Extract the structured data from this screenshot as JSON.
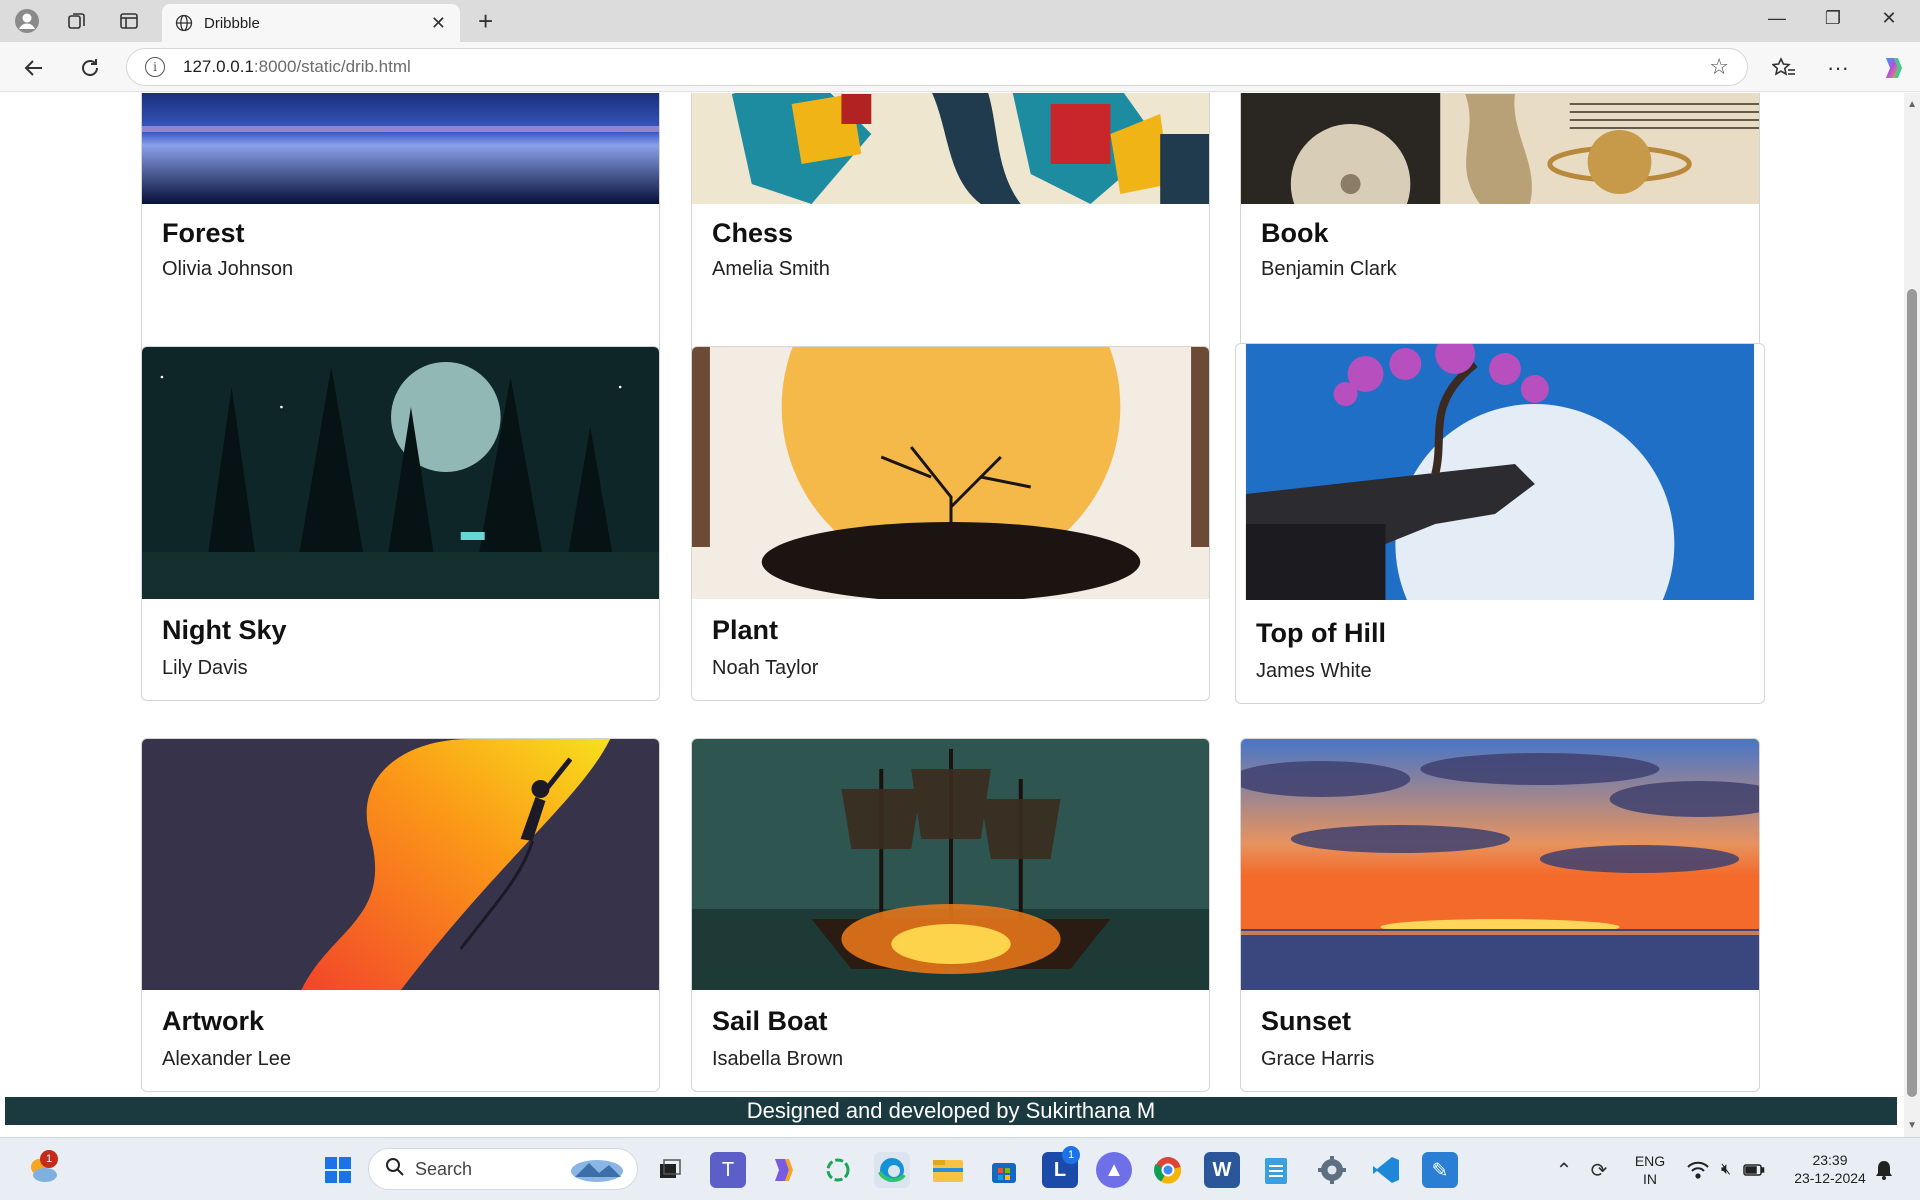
{
  "browser": {
    "tab_title": "Dribbble",
    "url_host": "127.0.0.1",
    "url_path": ":8000/static/drib.html"
  },
  "cards": [
    {
      "title": "Forest",
      "author": "Olivia Johnson"
    },
    {
      "title": "Chess",
      "author": "Amelia Smith"
    },
    {
      "title": "Book",
      "author": "Benjamin Clark"
    },
    {
      "title": "Night Sky",
      "author": "Lily Davis"
    },
    {
      "title": "Plant",
      "author": "Noah Taylor"
    },
    {
      "title": "Top of Hill",
      "author": "James White"
    },
    {
      "title": "Artwork",
      "author": "Alexander Lee"
    },
    {
      "title": "Sail Boat",
      "author": "Isabella Brown"
    },
    {
      "title": "Sunset",
      "author": "Grace Harris"
    }
  ],
  "footer": {
    "text": "Designed and developed by Sukirthana M"
  },
  "taskbar": {
    "search_placeholder": "Search",
    "weather_badge": "1",
    "app_badge": "1",
    "lang_line1": "ENG",
    "lang_line2": "IN",
    "time": "23:39",
    "date": "23-12-2024"
  },
  "colors": {
    "footer_bg": "#1b3a3f",
    "taskbar_bg": "#e9eef5"
  }
}
